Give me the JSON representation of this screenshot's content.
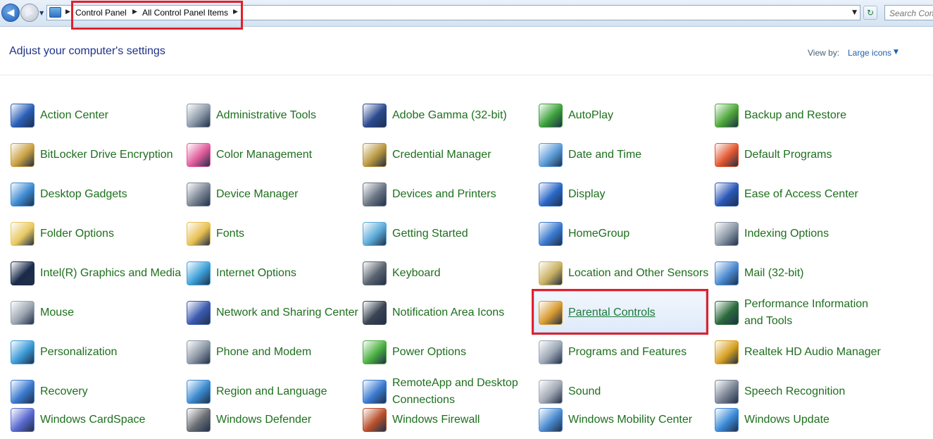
{
  "address_bar": {
    "crumbs": [
      "Control Panel",
      "All Control Panel Items"
    ],
    "search_placeholder": "Search Control Panel"
  },
  "header": {
    "title": "Adjust your computer's settings",
    "view_by_label": "View by:",
    "view_by_value": "Large icons"
  },
  "items": [
    {
      "label": "Action Center",
      "icon": "flag-icon",
      "color": "#2a5fb8"
    },
    {
      "label": "Administrative Tools",
      "icon": "admin-tools-icon",
      "color": "#8a98a8"
    },
    {
      "label": "Adobe Gamma (32-bit)",
      "icon": "monitor-gamma-icon",
      "color": "#2b4a8f"
    },
    {
      "label": "AutoPlay",
      "icon": "autoplay-icon",
      "color": "#3ca23c"
    },
    {
      "label": "Backup and Restore",
      "icon": "backup-icon",
      "color": "#4ea83a"
    },
    {
      "label": "BitLocker Drive Encryption",
      "icon": "bitlocker-key-icon",
      "color": "#c8a040"
    },
    {
      "label": "Color Management",
      "icon": "color-management-icon",
      "color": "#e05a9a"
    },
    {
      "label": "Credential Manager",
      "icon": "vault-icon",
      "color": "#b8963e"
    },
    {
      "label": "Date and Time",
      "icon": "calendar-clock-icon",
      "color": "#5a9ad8"
    },
    {
      "label": "Default Programs",
      "icon": "default-programs-icon",
      "color": "#e2562e"
    },
    {
      "label": "Desktop Gadgets",
      "icon": "gadgets-icon",
      "color": "#3d8ad2"
    },
    {
      "label": "Device Manager",
      "icon": "device-manager-icon",
      "color": "#7a8494"
    },
    {
      "label": "Devices and Printers",
      "icon": "printer-icon",
      "color": "#6a7584"
    },
    {
      "label": "Display",
      "icon": "display-icon",
      "color": "#2a68c8"
    },
    {
      "label": "Ease of Access Center",
      "icon": "ease-of-access-icon",
      "color": "#2a58b8"
    },
    {
      "label": "Folder Options",
      "icon": "folder-options-icon",
      "color": "#e8c860"
    },
    {
      "label": "Fonts",
      "icon": "fonts-icon",
      "color": "#e8c050"
    },
    {
      "label": "Getting Started",
      "icon": "getting-started-icon",
      "color": "#5aaad8"
    },
    {
      "label": "HomeGroup",
      "icon": "homegroup-icon",
      "color": "#3a7ad0"
    },
    {
      "label": "Indexing Options",
      "icon": "indexing-icon",
      "color": "#8a96a6"
    },
    {
      "label": "Intel(R) Graphics and Media",
      "icon": "intel-graphics-icon",
      "color": "#1a2a4a"
    },
    {
      "label": "Internet Options",
      "icon": "internet-options-icon",
      "color": "#3ca0d8"
    },
    {
      "label": "Keyboard",
      "icon": "keyboard-icon",
      "color": "#5a6470"
    },
    {
      "label": "Location and Other Sensors",
      "icon": "location-sensors-icon",
      "color": "#c8b060"
    },
    {
      "label": "Mail (32-bit)",
      "icon": "mail-icon",
      "color": "#4a8ad0"
    },
    {
      "label": "Mouse",
      "icon": "mouse-icon",
      "color": "#9aa4b0"
    },
    {
      "label": "Network and Sharing Center",
      "icon": "network-icon",
      "color": "#3a5ab0"
    },
    {
      "label": "Notification Area Icons",
      "icon": "notification-area-icon",
      "color": "#3a4452"
    },
    {
      "label": "Parental Controls",
      "icon": "parental-controls-icon",
      "color": "#d89a30"
    },
    {
      "label": "Performance Information and Tools",
      "icon": "performance-icon",
      "color": "#2a6a3a"
    },
    {
      "label": "Personalization",
      "icon": "personalization-icon",
      "color": "#3a9ad8"
    },
    {
      "label": "Phone and Modem",
      "icon": "phone-modem-icon",
      "color": "#8a96a4"
    },
    {
      "label": "Power Options",
      "icon": "power-options-icon",
      "color": "#4ab040"
    },
    {
      "label": "Programs and Features",
      "icon": "programs-features-icon",
      "color": "#9aa6b4"
    },
    {
      "label": "Realtek HD Audio Manager",
      "icon": "realtek-audio-icon",
      "color": "#d8a020"
    },
    {
      "label": "Recovery",
      "icon": "recovery-icon",
      "color": "#3a7ad0"
    },
    {
      "label": "Region and Language",
      "icon": "region-language-icon",
      "color": "#3a8ad0"
    },
    {
      "label": "RemoteApp and Desktop Connections",
      "icon": "remoteapp-icon",
      "color": "#3a7ad0"
    },
    {
      "label": "Sound",
      "icon": "sound-icon",
      "color": "#a0a8b4"
    },
    {
      "label": "Speech Recognition",
      "icon": "microphone-icon",
      "color": "#7a8494"
    },
    {
      "label": "Windows CardSpace",
      "icon": "cardspace-icon",
      "color": "#5a6ad0"
    },
    {
      "label": "Windows Defender",
      "icon": "defender-icon",
      "color": "#6a6e74"
    },
    {
      "label": "Windows Firewall",
      "icon": "firewall-icon",
      "color": "#b8502a"
    },
    {
      "label": "Windows Mobility Center",
      "icon": "mobility-center-icon",
      "color": "#4a8ad0"
    },
    {
      "label": "Windows Update",
      "icon": "windows-update-icon",
      "color": "#3a8ad8"
    }
  ],
  "selected_item": "Parental Controls"
}
